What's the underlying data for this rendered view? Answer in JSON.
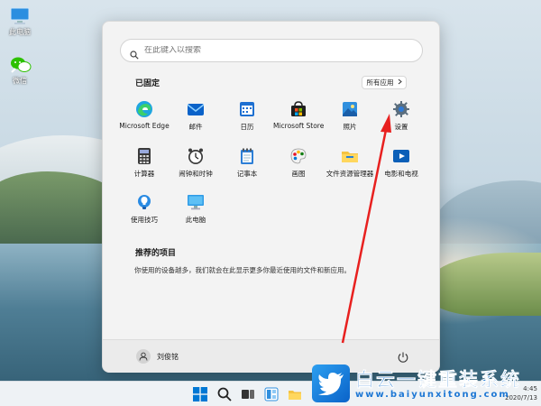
{
  "desktop": {
    "icons": [
      {
        "label": "此电脑"
      },
      {
        "label": "微信"
      }
    ]
  },
  "start_menu": {
    "search": {
      "placeholder": "在此键入以搜索"
    },
    "pinned": {
      "title": "已固定",
      "all_apps_label": "所有应用",
      "apps": [
        {
          "label": "Microsoft Edge",
          "icon": "edge-icon"
        },
        {
          "label": "邮件",
          "icon": "mail-icon"
        },
        {
          "label": "日历",
          "icon": "calendar-icon"
        },
        {
          "label": "Microsoft Store",
          "icon": "store-icon"
        },
        {
          "label": "照片",
          "icon": "photos-icon"
        },
        {
          "label": "设置",
          "icon": "gear-icon"
        },
        {
          "label": "计算器",
          "icon": "calculator-icon"
        },
        {
          "label": "闹钟和时钟",
          "icon": "clock-icon"
        },
        {
          "label": "记事本",
          "icon": "notepad-icon"
        },
        {
          "label": "画图",
          "icon": "paint-icon"
        },
        {
          "label": "文件资源管理器",
          "icon": "folder-icon"
        },
        {
          "label": "电影和电视",
          "icon": "movies-icon"
        },
        {
          "label": "使用技巧",
          "icon": "tips-icon"
        },
        {
          "label": "此电脑",
          "icon": "computer-icon"
        }
      ]
    },
    "recommended": {
      "title": "推荐的项目",
      "description": "你使用的设备越多，我们就会在此显示更多你最近使用的文件和新应用。"
    },
    "user": {
      "name": "刘俊铭"
    }
  },
  "taskbar": {
    "time": "4:45",
    "date": "2020/7/13"
  },
  "watermark": {
    "title": "白云一键重装系统",
    "url": "www.baiyunxitong.com"
  },
  "colors": {
    "accent": "#0067c0",
    "arrow": "#e8201f",
    "watermark": "#1d77d4"
  }
}
